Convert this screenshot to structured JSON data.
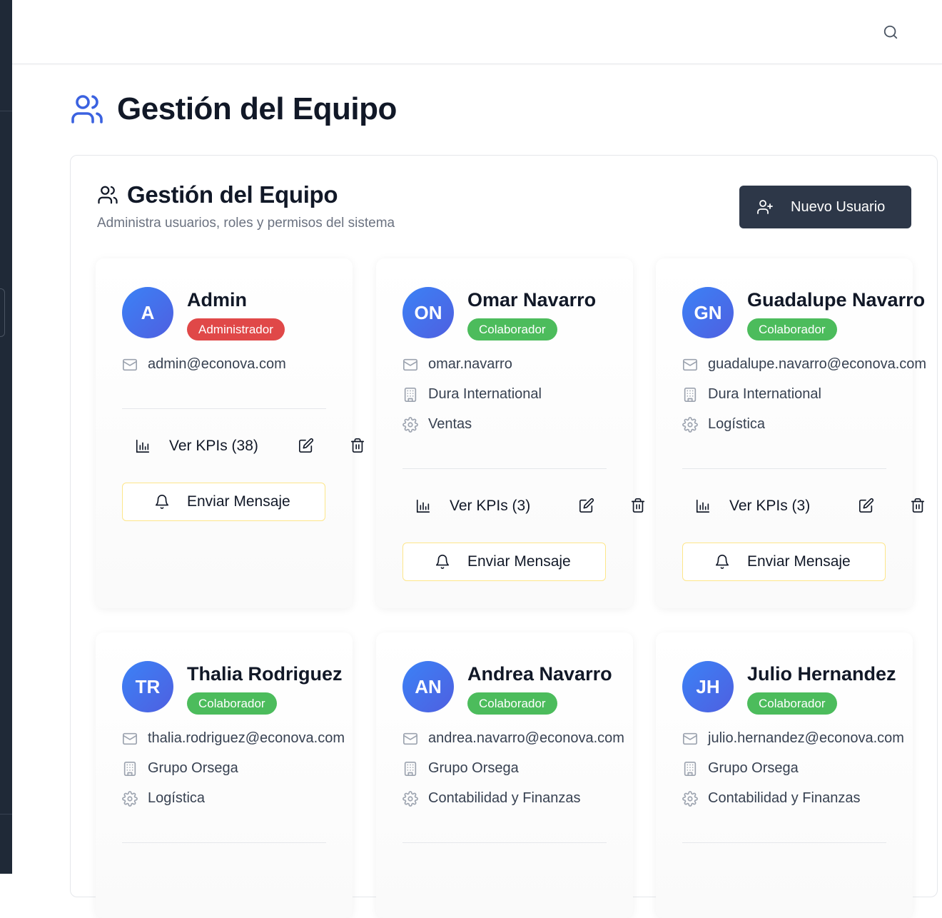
{
  "header": {
    "title": "Gestión del Equipo"
  },
  "panel": {
    "title": "Gestión del Equipo",
    "subtitle": "Administra usuarios, roles y permisos del sistema",
    "new_user_label": "Nuevo Usuario"
  },
  "users": [
    {
      "initials": "A",
      "name": "Admin",
      "role": "Administrador",
      "email": "admin@econova.com",
      "company": "",
      "department": "",
      "kpi_label": "Ver KPIs (38)",
      "message_label": "Enviar Mensaje"
    },
    {
      "initials": "ON",
      "name": "Omar Navarro",
      "role": "Colaborador",
      "email": "omar.navarro",
      "company": "Dura International",
      "department": "Ventas",
      "kpi_label": "Ver KPIs (3)",
      "message_label": "Enviar Mensaje"
    },
    {
      "initials": "GN",
      "name": "Guadalupe Navarro",
      "role": "Colaborador",
      "email": "guadalupe.navarro@econova.com",
      "company": "Dura International",
      "department": "Logística",
      "kpi_label": "Ver KPIs (3)",
      "message_label": "Enviar Mensaje"
    },
    {
      "initials": "TR",
      "name": "Thalia Rodriguez",
      "role": "Colaborador",
      "email": "thalia.rodriguez@econova.com",
      "company": "Grupo Orsega",
      "department": "Logística"
    },
    {
      "initials": "AN",
      "name": "Andrea Navarro",
      "role": "Colaborador",
      "email": "andrea.navarro@econova.com",
      "company": "Grupo Orsega",
      "department": "Contabilidad y Finanzas"
    },
    {
      "initials": "JH",
      "name": "Julio Hernandez",
      "role": "Colaborador",
      "email": "julio.hernandez@econova.com",
      "company": "Grupo Orsega",
      "department": "Contabilidad y Finanzas"
    }
  ],
  "colors": {
    "accent": "#3b82f6",
    "admin_badge": "#e04848",
    "colab_badge": "#4cbc5c",
    "primary_button": "#2d3748"
  }
}
